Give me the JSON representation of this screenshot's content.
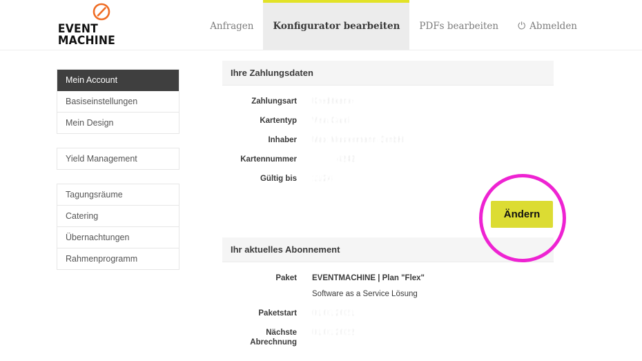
{
  "brand": {
    "logo_icon": "circle-slash-icon",
    "logo_color": "#ef6c23",
    "line1": "EVENT",
    "line2": "MACHINE"
  },
  "nav": {
    "items": [
      {
        "label": "Anfragen",
        "active": false,
        "icon": null
      },
      {
        "label": "Konfigurator bearbeiten",
        "active": true,
        "icon": null
      },
      {
        "label": "PDFs bearbeiten",
        "active": false,
        "icon": null
      },
      {
        "label": "Abmelden",
        "active": false,
        "icon": "power-icon",
        "glyph": "⏻"
      }
    ],
    "active_accent": "#e2e227"
  },
  "sidebar": {
    "groups": [
      {
        "items": [
          {
            "label": "Mein Account",
            "active": true
          },
          {
            "label": "Basiseinstellungen",
            "active": false
          },
          {
            "label": "Mein Design",
            "active": false
          }
        ]
      },
      {
        "items": [
          {
            "label": "Yield Management",
            "active": false
          }
        ]
      },
      {
        "items": [
          {
            "label": "Tagungsräume",
            "active": false
          },
          {
            "label": "Catering",
            "active": false
          },
          {
            "label": "Übernachtungen",
            "active": false
          },
          {
            "label": "Rahmenprogramm",
            "active": false
          }
        ]
      }
    ],
    "active_bg": "#3f3f3f"
  },
  "payment_panel": {
    "title": "Ihre Zahlungsdaten",
    "rows": [
      {
        "label": "Zahlungsart",
        "value": "Kreditkarte",
        "redacted": true,
        "indent": false
      },
      {
        "label": "Kartentyp",
        "value": "Visa Card",
        "redacted": true,
        "indent": false
      },
      {
        "label": "Inhaber",
        "value": "Max Mustermann GmbH",
        "redacted": true,
        "indent": false
      },
      {
        "label": "Kartennummer",
        "value": "4242",
        "redacted": true,
        "indent": true
      },
      {
        "label": "Gültig bis",
        "value": "11/24",
        "redacted": true,
        "indent": false
      }
    ],
    "change_button": "Ändern"
  },
  "subscription_panel": {
    "title": "Ihr aktuelles Abonnement",
    "rows": [
      {
        "label": "Paket",
        "value": "EVENTMACHINE | Plan \"Flex\"",
        "strong": true,
        "redacted": false,
        "indent": false
      },
      {
        "label": "",
        "value": "Software as a Service Lösung",
        "strong": false,
        "redacted": false,
        "indent": false
      },
      {
        "label": "Paketstart",
        "value": "01.01.2021",
        "strong": false,
        "redacted": true,
        "indent": false
      },
      {
        "label": "Nächste Abrechnung",
        "value": "01.01.2022",
        "strong": false,
        "redacted": true,
        "indent": false
      }
    ]
  },
  "annotation": {
    "shape": "circle-highlight",
    "color": "#ee23d2",
    "targets": "Ändern"
  }
}
